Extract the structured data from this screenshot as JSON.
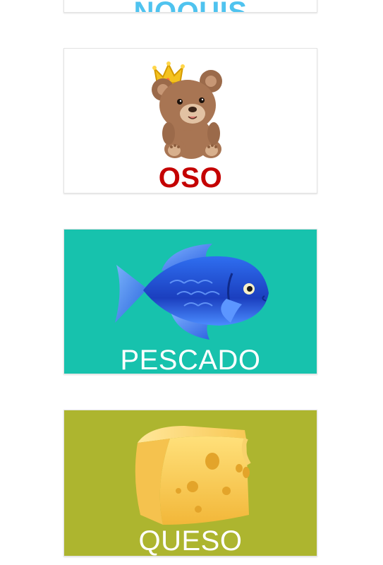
{
  "cards": [
    {
      "word": "ÑOQUIS",
      "bg": "#ffffff",
      "text_color": "#4fc3ef",
      "icon": "noquis-image"
    },
    {
      "word": "OSO",
      "bg": "#ffffff",
      "text_color": "#c40000",
      "icon": "teddy-bear-with-crown"
    },
    {
      "word": "PESCADO",
      "bg": "#17c2ad",
      "text_color": "#ffffff",
      "icon": "blue-fish"
    },
    {
      "word": "QUESO",
      "bg": "#adb52f",
      "text_color": "#ffffff",
      "icon": "cheese-wedge"
    }
  ]
}
